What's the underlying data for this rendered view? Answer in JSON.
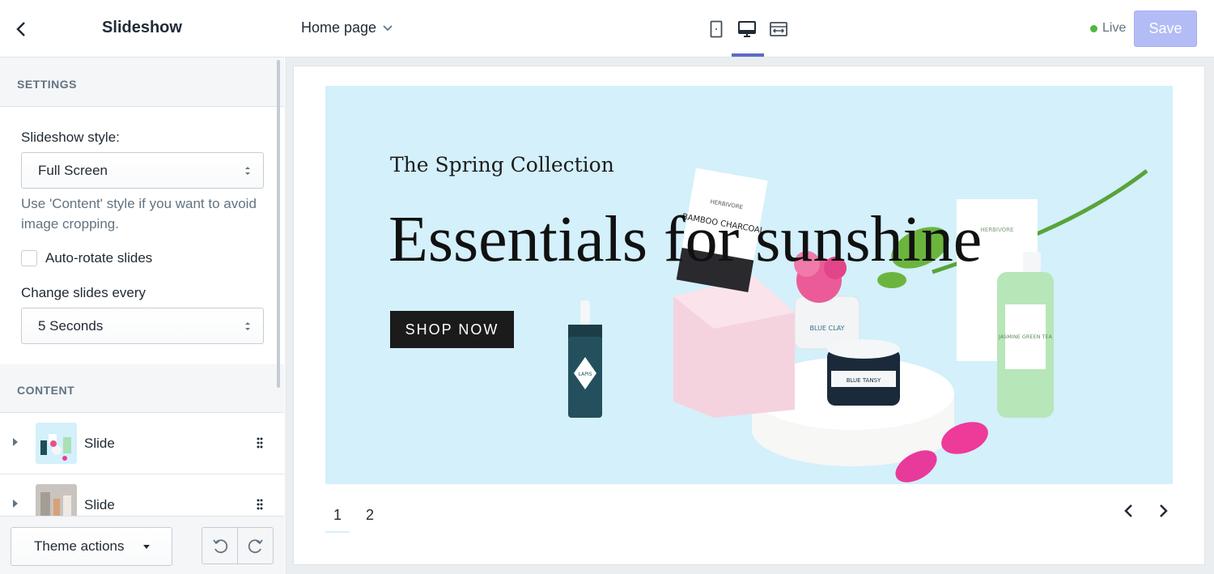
{
  "sidebar": {
    "title": "Slideshow",
    "settings_heading": "SETTINGS",
    "slideshow_style_label": "Slideshow style:",
    "slideshow_style_value": "Full Screen",
    "help_text": "Use 'Content' style if you want to avoid image cropping.",
    "auto_rotate_label": "Auto-rotate slides",
    "auto_rotate_checked": false,
    "change_slides_label": "Change slides every",
    "change_slides_value": "5 Seconds",
    "content_heading": "CONTENT",
    "slides": [
      {
        "label": "Slide"
      },
      {
        "label": "Slide"
      }
    ],
    "theme_actions_label": "Theme actions"
  },
  "topbar": {
    "page_select": "Home page",
    "live_label": "Live",
    "save_label": "Save",
    "active_device": "desktop"
  },
  "preview": {
    "hero_subtitle": "The Spring Collection",
    "hero_title": "Essentials for sunshine",
    "hero_button": "SHOP NOW",
    "pages": [
      "1",
      "2"
    ],
    "active_page": "1",
    "product_labels": [
      "HERBIVORE",
      "BAMBOO CHARCOAL",
      "BLUE CLAY",
      "BLUE TANSY",
      "LAPIS",
      "JASMINE GREEN TEA"
    ]
  },
  "colors": {
    "accent": "#5c6ac4",
    "save_disabled": "#b3bcf5",
    "live_dot": "#50b83c",
    "hero_bg": "#d3f0fb"
  }
}
